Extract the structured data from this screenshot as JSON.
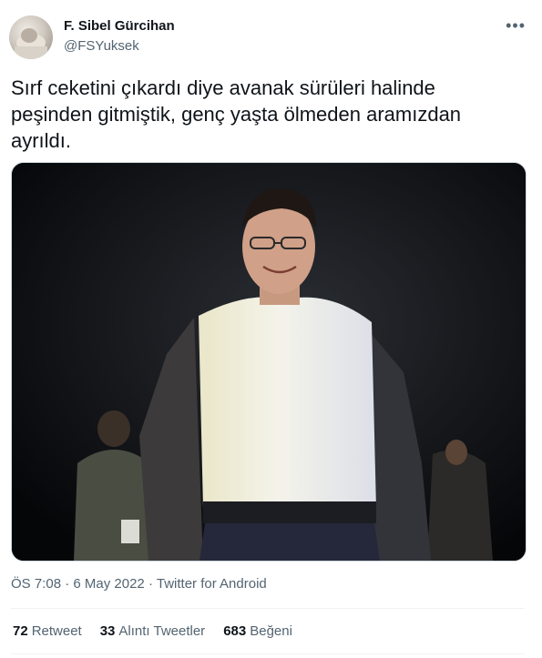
{
  "author": {
    "name": "F. Sibel Gürcihan",
    "handle": "@FSYuksek"
  },
  "more_label": "•••",
  "tweet": {
    "lines": [
      "Sırf ceketini çıkardı diye avanak sürüleri halinde",
      "peşinden gitmiştik, genç yaşta ölmeden aramızdan",
      "ayrıldı."
    ]
  },
  "meta": {
    "time": "ÖS 7:08",
    "separator1": "·",
    "date": "6 May 2022",
    "separator2": "·",
    "source": "Twitter for Android"
  },
  "stats": {
    "retweets": {
      "count": "72",
      "label": "Retweet"
    },
    "quotes": {
      "count": "33",
      "label": "Alıntı Tweetler"
    },
    "likes": {
      "count": "683",
      "label": "Beğeni"
    }
  },
  "colors": {
    "text": "#0f1419",
    "secondary": "#536471",
    "border": "#eff3f4"
  }
}
